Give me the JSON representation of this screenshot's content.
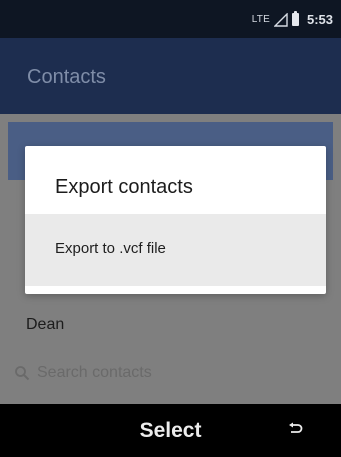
{
  "status_bar": {
    "network": "LTE",
    "time": "5:53"
  },
  "app_bar": {
    "title": "Contacts"
  },
  "contacts": {
    "visible_contact": "Dean"
  },
  "search": {
    "placeholder": "Search contacts",
    "icon": "search-icon"
  },
  "dialog": {
    "title": "Export contacts",
    "items": [
      {
        "label": "Export to .vcf file",
        "selected": true
      }
    ]
  },
  "softkeys": {
    "center_label": "Select",
    "right_icon": "back-icon"
  },
  "colors": {
    "status_bar_bg": "#0e1623",
    "app_bar_bg": "#1d2d4f",
    "accent_strip": "#4a5e85",
    "dialog_bg": "#ffffff",
    "selected_item_bg": "#eaeaea",
    "softkey_bar_bg": "#000000"
  }
}
